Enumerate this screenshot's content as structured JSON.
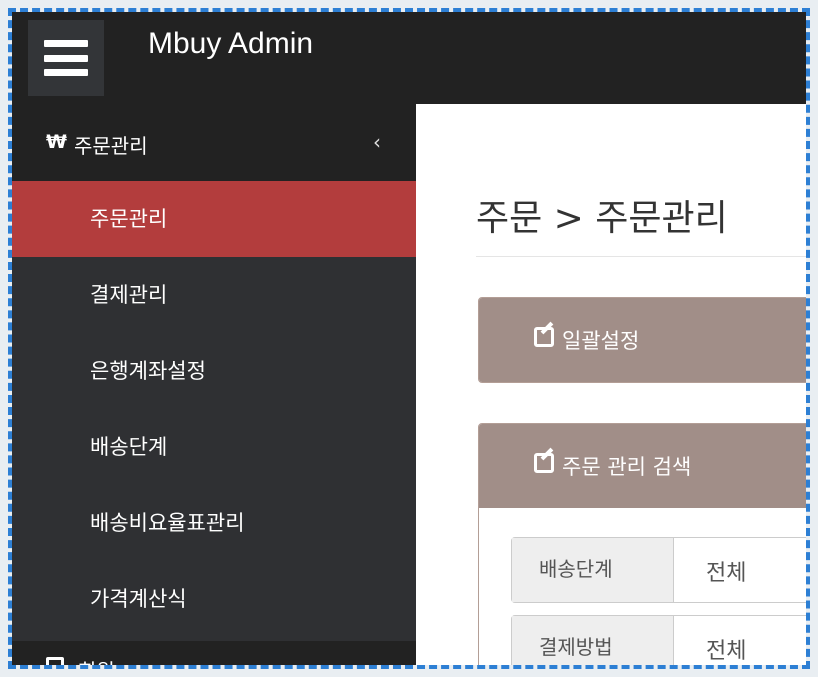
{
  "header": {
    "brand": "Mbuy Admin",
    "menu_icon": "hamburger-menu-icon"
  },
  "sidebar": {
    "group": {
      "icon_glyph": "₩",
      "icon": "won-icon",
      "label": "주문관리",
      "chevron": "‹"
    },
    "items": [
      {
        "label": "주문관리",
        "active": true
      },
      {
        "label": "결제관리",
        "active": false
      },
      {
        "label": "은행계좌설정",
        "active": false
      },
      {
        "label": "배송단계",
        "active": false
      },
      {
        "label": "배송비요율표관리",
        "active": false
      },
      {
        "label": "가격계산식",
        "active": false
      }
    ],
    "next_group": {
      "label": "회원",
      "icon": "user-square-icon"
    }
  },
  "main": {
    "page_title": "주문 > 주문관리",
    "bulk_panel": {
      "icon": "edit-icon",
      "title": "일괄설정"
    },
    "search_panel": {
      "icon": "edit-icon",
      "title": "주문 관리 검색",
      "rows": [
        {
          "label": "배송단계",
          "value": "전체"
        },
        {
          "label": "결제방법",
          "value": "전체"
        }
      ]
    }
  },
  "colors": {
    "topbar": "#222222",
    "sidebar": "#2f3033",
    "active_item": "#b33d3d",
    "panel_header": "#a18e88",
    "frame_dash": "#2d7fd4"
  }
}
